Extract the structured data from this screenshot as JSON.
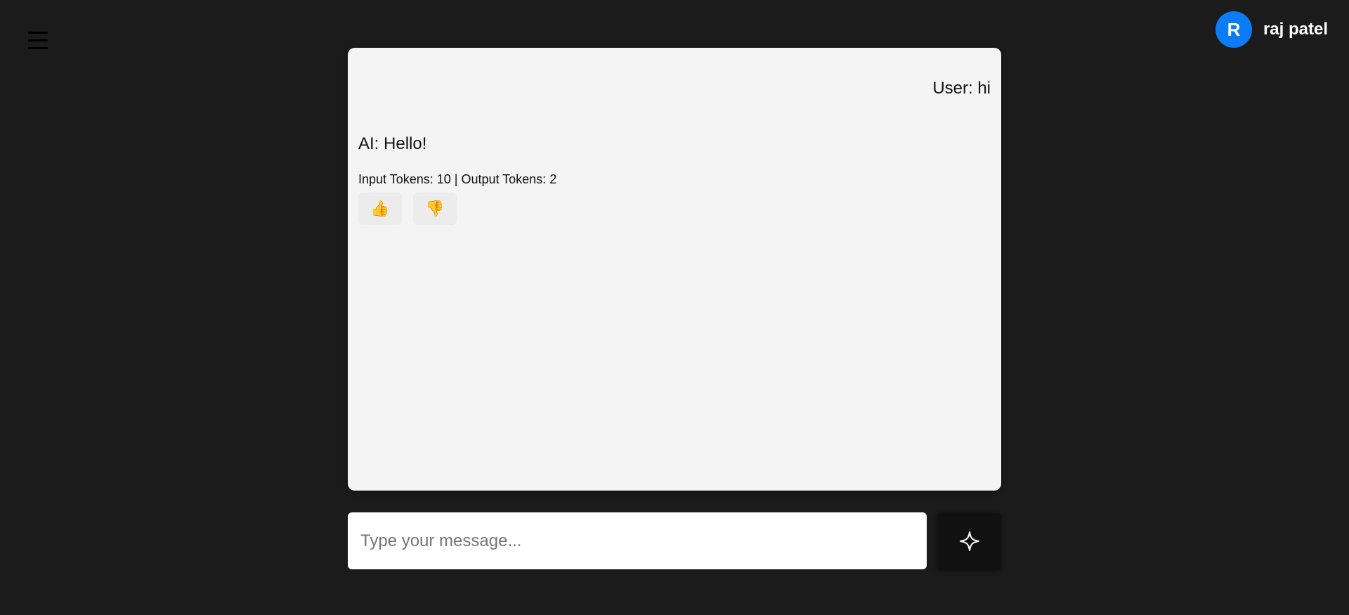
{
  "header": {
    "menu_icon": "hamburger-icon",
    "user": {
      "avatar_initial": "R",
      "name": "raj patel",
      "avatar_color": "#0b7cf5"
    }
  },
  "chat": {
    "messages": [
      {
        "role": "user",
        "text": "User: hi"
      },
      {
        "role": "ai",
        "text": "AI: Hello!"
      }
    ],
    "token_info": "Input Tokens: 10 | Output Tokens: 2",
    "feedback": {
      "thumbs_up": "👍",
      "thumbs_down": "👎"
    }
  },
  "composer": {
    "placeholder": "Type your message...",
    "send_icon": "sparkle-icon"
  },
  "colors": {
    "background": "#1b1b1b",
    "panel": "#f4f4f4",
    "accent": "#0b7cf5"
  }
}
